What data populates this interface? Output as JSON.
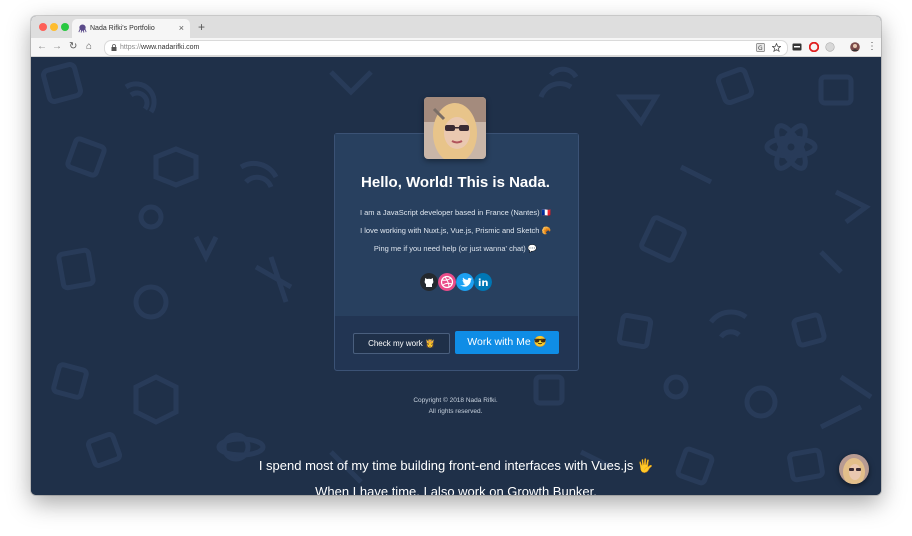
{
  "browser": {
    "tab_title": "Nada Rifki's Portfolio",
    "tab_close": "×",
    "new_tab": "+",
    "url_scheme": "https://",
    "url_host": "www.nadarifki.com",
    "nav": {
      "back": "←",
      "forward": "→",
      "reload": "↻",
      "home": "⌂"
    },
    "menu": "⋮"
  },
  "card": {
    "headline": "Hello, World! This is Nada.",
    "bio": [
      "I am a JavaScript developer based in France (Nantes) 🇫🇷",
      "I love working with Nuxt.js, Vue.js, Prismic and Sketch 🥐",
      "Ping me if you need help (or just wanna' chat) 💬"
    ],
    "social": [
      "github",
      "dribbble",
      "twitter",
      "linkedin"
    ],
    "linkedin_label": "in",
    "buttons": {
      "check_work": "Check my work 👸",
      "work_with_me": "Work with Me 😎"
    }
  },
  "footer": {
    "copyright": "Copyright © 2018 Nada Rifki.",
    "rights": "All rights reserved."
  },
  "tagline": [
    "I spend most of my time building front-end interfaces with Vues.js 🖐",
    "When I have time, I also work on Growth Bunker,"
  ],
  "colors": {
    "page_bg": "#1f3049",
    "card_bg": "#28405f",
    "primary_button": "#0f8de6",
    "github": "#24292e",
    "dribbble": "#ea4c89",
    "twitter": "#1da1f2",
    "linkedin": "#0077b5"
  },
  "icons": {
    "favicon": "octopus-icon",
    "lock": "lock-icon",
    "translate": "translate-icon",
    "bookmark": "star-icon"
  }
}
